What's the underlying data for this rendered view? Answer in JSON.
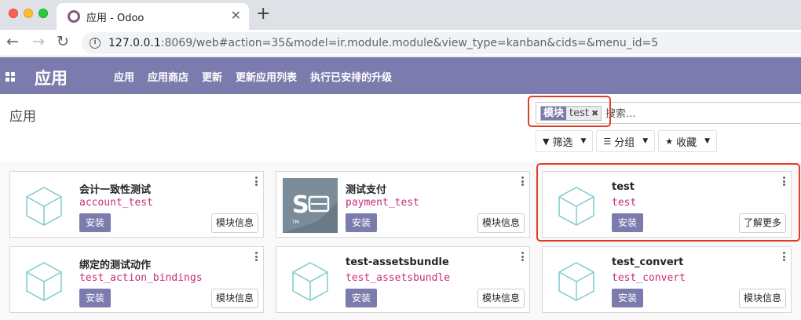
{
  "browser": {
    "tab_title": "应用 - Odoo",
    "url_host": "127.0.0.1",
    "url_rest": ":8069/web#action=35&model=ir.module.module&view_type=kanban&cids=&menu_id=5"
  },
  "nav": {
    "app_title": "应用",
    "menu": [
      "应用",
      "应用商店",
      "更新",
      "更新应用列表",
      "执行已安排的升级"
    ]
  },
  "control_panel": {
    "breadcrumb": "应用",
    "facet_label": "模块",
    "facet_value": "test",
    "search_placeholder": "搜索...",
    "filters_label": "筛选",
    "groupby_label": "分组",
    "favorites_label": "收藏"
  },
  "colors": {
    "brand": "#7c7bad",
    "tech_name": "#c72d7a",
    "highlight": "#e23d2a"
  },
  "modules": [
    {
      "name": "会计一致性测试",
      "tech": "account_test",
      "action": "安装",
      "info": "模块信息",
      "icon": "cube-icon"
    },
    {
      "name": "测试支付",
      "tech": "payment_test",
      "action": "安装",
      "info": "模块信息",
      "icon": "payment-test-icon"
    },
    {
      "name": "test",
      "tech": "test",
      "action": "安装",
      "info": "了解更多",
      "icon": "cube-icon"
    },
    {
      "name": "绑定的测试动作",
      "tech": "test_action_bindings",
      "action": "安装",
      "info": "模块信息",
      "icon": "cube-icon"
    },
    {
      "name": "test-assetsbundle",
      "tech": "test_assetsbundle",
      "action": "安装",
      "info": "模块信息",
      "icon": "cube-icon"
    },
    {
      "name": "test_convert",
      "tech": "test_convert",
      "action": "安装",
      "info": "模块信息",
      "icon": "cube-icon"
    }
  ]
}
